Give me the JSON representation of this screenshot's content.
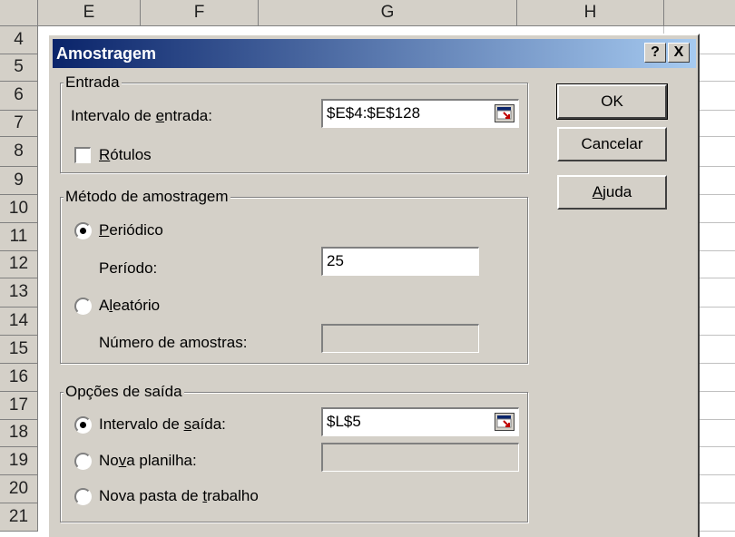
{
  "spreadsheet": {
    "columns": [
      "E",
      "F",
      "G",
      "H"
    ],
    "rows": [
      "4",
      "5",
      "6",
      "7",
      "8",
      "9",
      "10",
      "11",
      "12",
      "13",
      "14",
      "15",
      "16",
      "17",
      "18",
      "19",
      "20",
      "21"
    ]
  },
  "dialog": {
    "title": "Amostragem",
    "help_button": "?",
    "close_button": "X",
    "input_group": {
      "legend": "Entrada",
      "range_label": "Intervalo de entrada:",
      "range_value": "$E$4:$E$128",
      "labels_checkbox": "Rótulos",
      "labels_checked": false
    },
    "method_group": {
      "legend": "Método de amostragem",
      "periodic_label": "Periódico",
      "periodic_selected": true,
      "period_label": "Período:",
      "period_value": "25",
      "random_label": "Aleatório",
      "random_selected": false,
      "num_samples_label": "Número de amostras:",
      "num_samples_value": ""
    },
    "output_group": {
      "legend": "Opções de saída",
      "output_range_label": "Intervalo de saída:",
      "output_range_selected": true,
      "output_range_value": "$L$5",
      "new_sheet_label": "Nova planilha:",
      "new_sheet_selected": false,
      "new_sheet_value": "",
      "new_workbook_label": "Nova pasta de trabalho",
      "new_workbook_selected": false
    },
    "buttons": {
      "ok": "OK",
      "cancel": "Cancelar",
      "help": "Ajuda"
    }
  },
  "colors": {
    "title_start": "#0a246a",
    "title_end": "#a6caf0",
    "face": "#d4d0c8"
  }
}
